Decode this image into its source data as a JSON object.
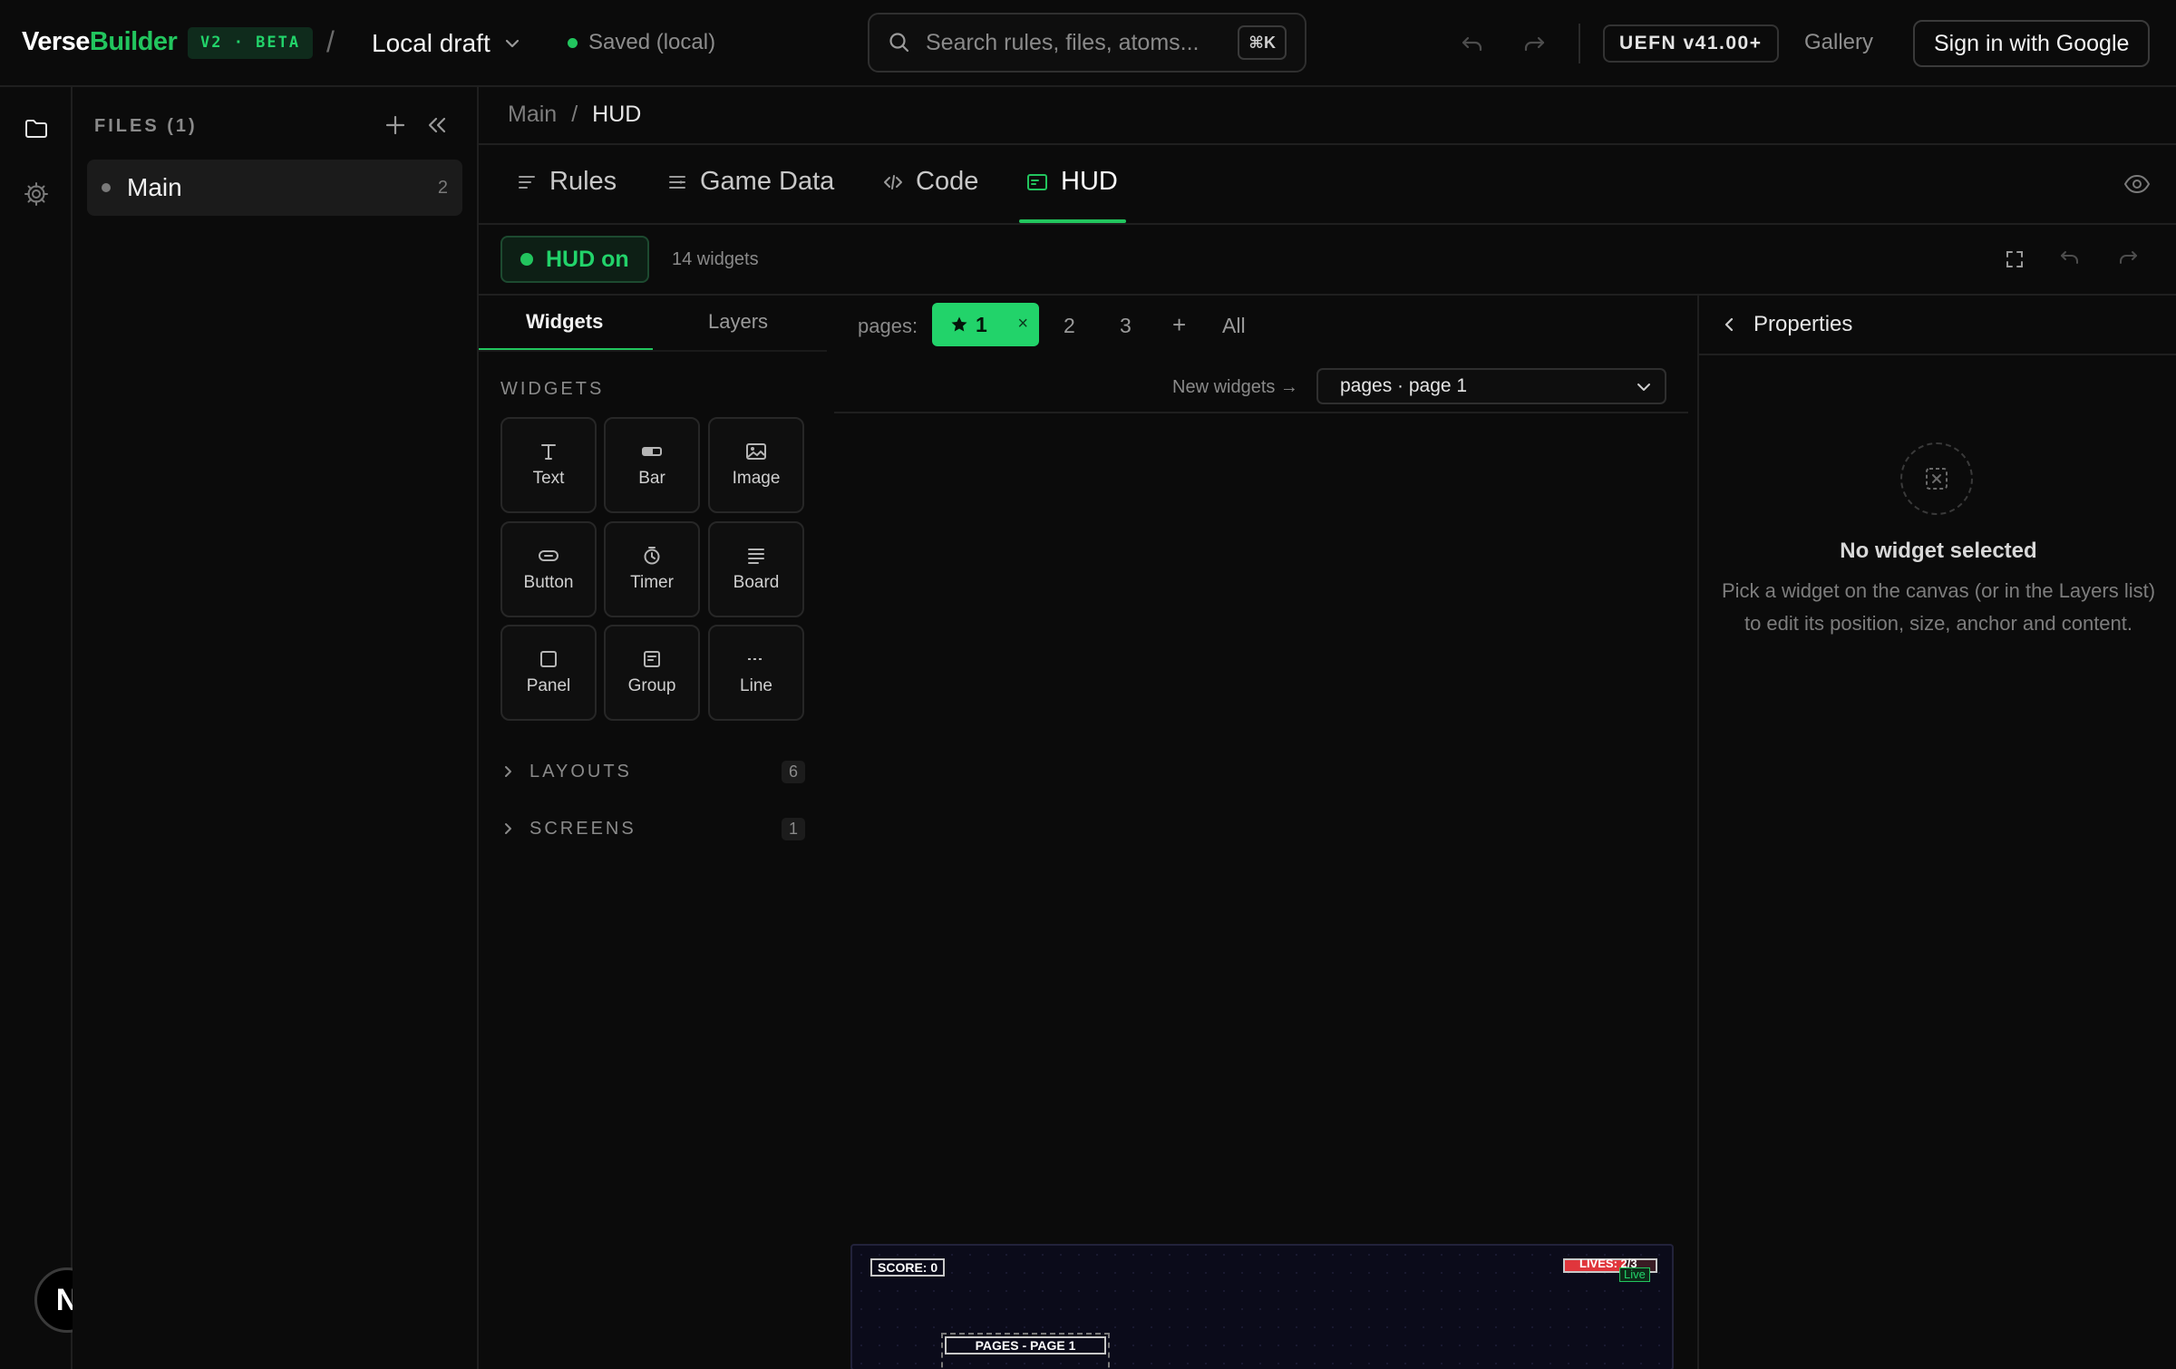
{
  "header": {
    "logo_part1": "Verse",
    "logo_part2": "Builder",
    "beta_badge": "V2 · BETA",
    "separator": "/",
    "draft_label": "Local draft",
    "saved_status": "Saved (local)",
    "search_placeholder": "Search rules, files, atoms...",
    "search_shortcut": "⌘K",
    "version_badge": "UEFN v41.00+",
    "gallery_label": "Gallery",
    "signin_label": "Sign in with Google"
  },
  "rail": {
    "items": [
      {
        "icon": "folder-icon"
      },
      {
        "icon": "gear-icon"
      }
    ],
    "avatar_initial": "N"
  },
  "files": {
    "title": "FILES (1)",
    "items": [
      {
        "name": "Main",
        "count": "2"
      }
    ]
  },
  "breadcrumb": {
    "parent": "Main",
    "separator": "/",
    "current": "HUD"
  },
  "tabs": [
    {
      "label": "Rules",
      "icon": "list-icon"
    },
    {
      "label": "Game Data",
      "icon": "data-icon"
    },
    {
      "label": "Code",
      "icon": "code-icon"
    },
    {
      "label": "HUD",
      "icon": "hud-icon",
      "active": true
    }
  ],
  "hud_toolbar": {
    "status_label": "HUD on",
    "widget_count": "14 widgets"
  },
  "left_panel": {
    "subtabs": [
      "Widgets",
      "Layers"
    ],
    "widgets_heading": "WIDGETS",
    "widgets": [
      {
        "label": "Text",
        "icon": "text-icon"
      },
      {
        "label": "Bar",
        "icon": "bar-icon"
      },
      {
        "label": "Image",
        "icon": "image-icon"
      },
      {
        "label": "Button",
        "icon": "button-icon"
      },
      {
        "label": "Timer",
        "icon": "timer-icon"
      },
      {
        "label": "Board",
        "icon": "board-icon"
      },
      {
        "label": "Panel",
        "icon": "panel-icon"
      },
      {
        "label": "Group",
        "icon": "group-icon"
      },
      {
        "label": "Line",
        "icon": "line-icon"
      }
    ],
    "sections": [
      {
        "label": "LAYOUTS",
        "count": "6"
      },
      {
        "label": "SCREENS",
        "count": "1"
      }
    ]
  },
  "pages": {
    "label": "pages:",
    "active_page": "1",
    "close_glyph": "×",
    "others": [
      "2",
      "3"
    ],
    "add_label": "+",
    "all_label": "All",
    "new_widgets_label": "New widgets →",
    "target_select_value": "pages · page 1"
  },
  "canvas": {
    "score_text": "SCORE: 0",
    "lives_text": "LIVES: 2/3",
    "lives_fraction": 0.67,
    "live_tag": "Live",
    "page_banner": "PAGES - PAGE 1"
  },
  "properties": {
    "title": "Properties",
    "empty_title": "No widget selected",
    "empty_description": "Pick a widget on the canvas (or in the Layers list) to edit its position, size, anchor and content."
  },
  "colors": {
    "accent": "#22c55e",
    "accent_bright": "#22d36a",
    "background": "#0b0b0b",
    "danger": "#e0363c"
  }
}
